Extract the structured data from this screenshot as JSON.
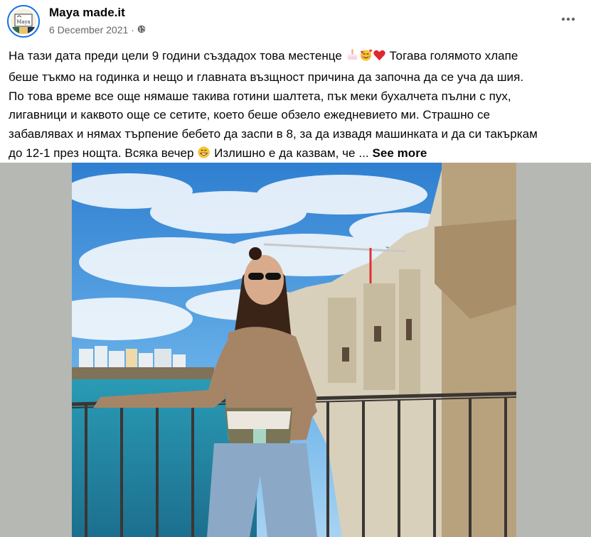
{
  "post": {
    "author": "Maya made.it",
    "date": "6 December 2021",
    "separator": "·",
    "avatar_text": "Maya",
    "lines": [
      "На тази дата преди цели 9 години създадох това местенце",
      "Тогава голямото хлапе",
      "беше тъкмо на годинка и нещо и главната възщност причина да започна да се уча да шия.",
      "По това време все още нямаше такива готини шалтета, пък меки бухалчета пълни с пух,",
      "лигавници и каквото още се сетите, което беше обзело ежедневието ми. Страшно се",
      "забавлявах и нямах търпение бебето да заспи в 8, за да извадя машинката и да си такъркам",
      "до 12-1 през нощта. Всяка вечер",
      "Излишно е да казвам, че ...",
      "See more"
    ]
  },
  "icons": {
    "privacy": "globe-icon",
    "more": "more-horizontal-icon",
    "emoji_1": "cake-emoji",
    "emoji_2": "smiling-face-with-hearts-emoji",
    "emoji_3": "red-heart-emoji",
    "emoji_4": "grinning-face-emoji"
  },
  "colors": {
    "text": "#050505",
    "secondary_text": "#65676b",
    "avatar_ring": "#1b74e4",
    "media_background": "#b6b8b3"
  }
}
